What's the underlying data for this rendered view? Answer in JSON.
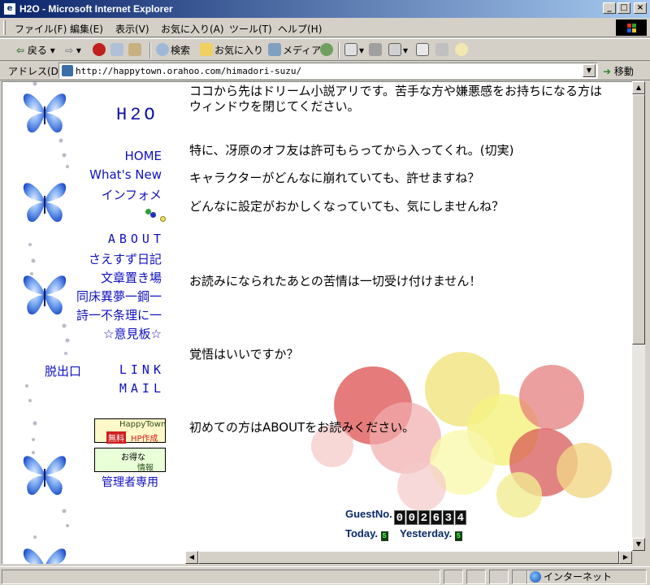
{
  "window": {
    "title": "H2O - Microsoft Internet Explorer",
    "icon_letter": "e"
  },
  "menubar": [
    "ファイル(F)",
    "編集(E)",
    "表示(V)",
    "お気に入り(A)",
    "ツール(T)",
    "ヘルプ(H)"
  ],
  "toolbar": {
    "back": "戻る",
    "search": "検索",
    "favorites": "お気に入り",
    "media": "メディア"
  },
  "address": {
    "label": "アドレス(D)",
    "url": "http://happytown.orahoo.com/himadori-suzu/",
    "go": "移動"
  },
  "sidebar": {
    "site_title": "H2O",
    "links_top": [
      "HOME",
      "What's New",
      "インフォメ"
    ],
    "links_middle": [
      "ABOUT",
      "さえすず日記",
      "文章置き場",
      "同床異夢一鋼一",
      "詩一不条理に一",
      "☆意見板☆"
    ],
    "exit": "脱出口",
    "link": "LINK",
    "mail": "MAIL",
    "banner1": {
      "top": "HappyTown",
      "free": "無料",
      "hp": "HP作成"
    },
    "banner2": {
      "top": "お得な",
      "bottom": "情報"
    },
    "admin": "管理者専用"
  },
  "main": {
    "p1_line1": "ココから先はドリーム小説アリです。苦手な方や嫌悪感をお持ちになる方は",
    "p1_line2": "ウィンドウを閉じてください。",
    "p2": "特に、冴原のオフ友は許可もらってから入ってくれ。(切実)",
    "p3": "キャラクターがどんなに崩れていても、許せますね？",
    "p4": "どんなに設定がおかしくなっていても、気にしませんね？",
    "p5": "お読みになられたあとの苦情は一切受け付けません！",
    "p6": "覚悟はいいですか？",
    "p7": "初めての方はABOUTをお読みください。",
    "counter_label": "GuestNo.",
    "counter_digits": [
      "0",
      "0",
      "2",
      "6",
      "3",
      "4"
    ],
    "today_label": "Today.",
    "today_value": "5",
    "yesterday_label": "Yesterday.",
    "yesterday_value": "5"
  },
  "status": {
    "zone": "インターネット"
  }
}
